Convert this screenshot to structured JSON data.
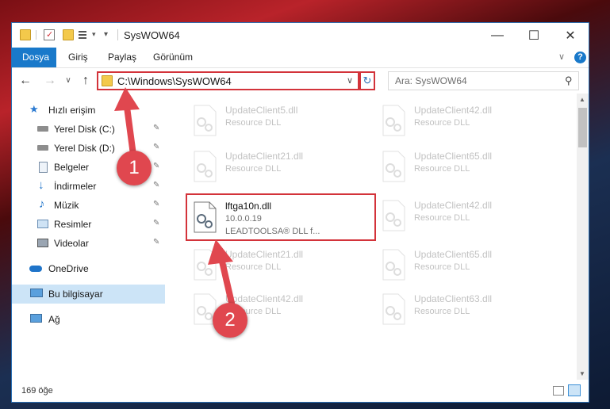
{
  "window": {
    "title": "SysWOW64"
  },
  "title_buttons": {
    "minimize": "—",
    "maximize": "☐",
    "close": "✕"
  },
  "ribbon": {
    "tabs": [
      {
        "label": "Dosya",
        "active": true
      },
      {
        "label": "Giriş"
      },
      {
        "label": "Paylaş"
      },
      {
        "label": "Görünüm"
      }
    ],
    "collapse": "∨",
    "help": "?"
  },
  "nav": {
    "back": "←",
    "forward": "→",
    "recent": "∨",
    "up": "↑",
    "path": "C:\\Windows\\SysWOW64",
    "dropdown": "∨",
    "refresh": "↻",
    "search_placeholder": "Ara: SysWOW64",
    "search_icon": "⚲"
  },
  "sidebar": {
    "items": [
      {
        "label": "Hızlı erişim",
        "icon": "star-icon"
      },
      {
        "label": "Yerel Disk (C:)",
        "icon": "drive-icon",
        "pinned": true
      },
      {
        "label": "Yerel Disk (D:)",
        "icon": "drive-icon",
        "pinned": true
      },
      {
        "label": "Belgeler",
        "icon": "documents-icon",
        "pinned": true
      },
      {
        "label": "İndirmeler",
        "icon": "download-icon",
        "pinned": true
      },
      {
        "label": "Müzik",
        "icon": "music-icon",
        "pinned": true
      },
      {
        "label": "Resimler",
        "icon": "pictures-icon",
        "pinned": true
      },
      {
        "label": "Videolar",
        "icon": "videos-icon",
        "pinned": true
      },
      {
        "label": "OneDrive",
        "icon": "cloud-icon"
      },
      {
        "label": "Bu bilgisayar",
        "icon": "computer-icon",
        "selected": true
      },
      {
        "label": "Ağ",
        "icon": "network-icon"
      }
    ],
    "pin_glyph": "✎"
  },
  "files": [
    {
      "name": "UpdateClient5.dll",
      "type": "Resource DLL"
    },
    {
      "name": "UpdateClient42.dll",
      "type": "Resource DLL"
    },
    {
      "name": "UpdateClient21.dll",
      "type": "Resource DLL"
    },
    {
      "name": "UpdateClient65.dll",
      "type": "Resource DLL"
    },
    {
      "name": "lftga10n.dll",
      "version": "10.0.0.19",
      "type": "LEADTOOLSA® DLL f...",
      "highlighted": true
    },
    {
      "name": "UpdateClient42.dll",
      "type": "Resource DLL"
    },
    {
      "name": "UpdateClient21.dll",
      "type": "Resource DLL"
    },
    {
      "name": "UpdateClient65.dll",
      "type": "Resource DLL"
    },
    {
      "name": "UpdateClient42.dll",
      "type": "Resource DLL"
    },
    {
      "name": "UpdateClient63.dll",
      "type": "Resource DLL"
    }
  ],
  "status": {
    "item_count": "169 öğe"
  },
  "callouts": [
    {
      "label": "1"
    },
    {
      "label": "2"
    }
  ],
  "colors": {
    "accent": "#1979ca",
    "highlight": "#d3333a",
    "callout": "#e0474f",
    "folder": "#f3c94b"
  }
}
